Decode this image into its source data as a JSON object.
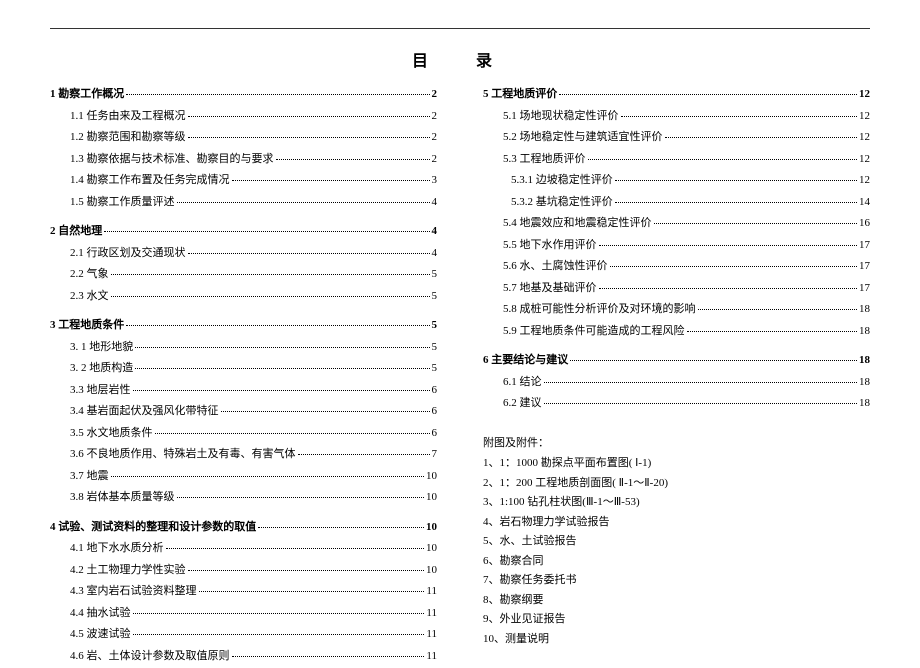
{
  "title": "目　录",
  "left": [
    {
      "type": "chapter",
      "num": "1",
      "label": "勘察工作概况",
      "page": "2"
    },
    {
      "type": "item",
      "indent": 1,
      "num": "1.1",
      "label": "任务由来及工程概况",
      "page": "2"
    },
    {
      "type": "item",
      "indent": 1,
      "num": "1.2",
      "label": "勘察范围和勘察等级",
      "page": "2"
    },
    {
      "type": "item",
      "indent": 1,
      "num": "1.3",
      "label": "勘察依据与技术标准、勘察目的与要求",
      "page": "2"
    },
    {
      "type": "item",
      "indent": 1,
      "num": "1.4",
      "label": "勘察工作布置及任务完成情况",
      "page": "3"
    },
    {
      "type": "item",
      "indent": 1,
      "num": "1.5",
      "label": "勘察工作质量评述",
      "page": "4"
    },
    {
      "type": "gap"
    },
    {
      "type": "chapter",
      "num": "2",
      "label": "自然地理",
      "page": "4"
    },
    {
      "type": "item",
      "indent": 1,
      "num": "2.1",
      "label": "行政区划及交通现状",
      "page": "4"
    },
    {
      "type": "item",
      "indent": 1,
      "num": "2.2",
      "label": "气象",
      "page": "5"
    },
    {
      "type": "item",
      "indent": 1,
      "num": "2.3",
      "label": "水文",
      "page": "5"
    },
    {
      "type": "gap"
    },
    {
      "type": "chapter",
      "num": "3",
      "label": "工程地质条件",
      "page": "5"
    },
    {
      "type": "item",
      "indent": 1,
      "num": "3. 1",
      "label": "地形地貌",
      "page": "5"
    },
    {
      "type": "item",
      "indent": 1,
      "num": "3. 2",
      "label": "地质构造",
      "page": "5"
    },
    {
      "type": "item",
      "indent": 1,
      "num": "3.3",
      "label": "地层岩性",
      "page": "6"
    },
    {
      "type": "item",
      "indent": 1,
      "num": "3.4",
      "label": "基岩面起伏及强风化带特征",
      "page": "6"
    },
    {
      "type": "item",
      "indent": 1,
      "num": "3.5",
      "label": "水文地质条件",
      "page": "6"
    },
    {
      "type": "item",
      "indent": 1,
      "num": "3.6",
      "label": "不良地质作用、特殊岩土及有毒、有害气体",
      "page": "7"
    },
    {
      "type": "item",
      "indent": 1,
      "num": "3.7",
      "label": "地震",
      "page": "10"
    },
    {
      "type": "item",
      "indent": 1,
      "num": "3.8",
      "label": "岩体基本质量等级",
      "page": "10"
    },
    {
      "type": "gap"
    },
    {
      "type": "chapter",
      "num": "4",
      "label": "试验、测试资料的整理和设计参数的取值",
      "page": "10"
    },
    {
      "type": "item",
      "indent": 1,
      "num": "4.1",
      "label": "地下水水质分析",
      "page": "10"
    },
    {
      "type": "item",
      "indent": 1,
      "num": "4.2",
      "label": "土工物理力学性实验",
      "page": "10"
    },
    {
      "type": "item",
      "indent": 1,
      "num": "4.3",
      "label": "室内岩石试验资料整理",
      "page": "11"
    },
    {
      "type": "item",
      "indent": 1,
      "num": "4.4",
      "label": "抽水试验",
      "page": "11"
    },
    {
      "type": "item",
      "indent": 1,
      "num": "4.5",
      "label": "波速试验",
      "page": "11"
    },
    {
      "type": "item",
      "indent": 1,
      "num": "4.6",
      "label": "岩、土体设计参数及取值原则",
      "page": "11"
    }
  ],
  "right": [
    {
      "type": "chapter",
      "num": "5",
      "label": "工程地质评价",
      "page": "12"
    },
    {
      "type": "item",
      "indent": 1,
      "num": "5.1",
      "label": "场地现状稳定性评价",
      "page": "12"
    },
    {
      "type": "item",
      "indent": 1,
      "num": "5.2",
      "label": "场地稳定性与建筑适宜性评价",
      "page": "12"
    },
    {
      "type": "item",
      "indent": 1,
      "num": "5.3",
      "label": "工程地质评价",
      "page": "12"
    },
    {
      "type": "item",
      "indent": 2,
      "num": "5.3.1",
      "label": "边坡稳定性评价",
      "page": "12"
    },
    {
      "type": "item",
      "indent": 2,
      "num": "5.3.2",
      "label": "基坑稳定性评价",
      "page": "14"
    },
    {
      "type": "item",
      "indent": 1,
      "num": "5.4",
      "label": "地震效应和地震稳定性评价",
      "page": "16"
    },
    {
      "type": "item",
      "indent": 1,
      "num": "5.5",
      "label": "地下水作用评价",
      "page": "17"
    },
    {
      "type": "item",
      "indent": 1,
      "num": "5.6",
      "label": "水、土腐蚀性评价",
      "page": "17"
    },
    {
      "type": "item",
      "indent": 1,
      "num": "5.7",
      "label": "地基及基础评价",
      "page": "17"
    },
    {
      "type": "item",
      "indent": 1,
      "num": "5.8",
      "label": "成桩可能性分析评价及对环境的影响",
      "page": "18"
    },
    {
      "type": "item",
      "indent": 1,
      "num": "5.9",
      "label": "工程地质条件可能造成的工程风险",
      "page": "18"
    },
    {
      "type": "gap"
    },
    {
      "type": "chapter",
      "num": "6",
      "label": "主要结论与建议",
      "page": "18"
    },
    {
      "type": "item",
      "indent": 1,
      "num": "6.1",
      "label": "结论",
      "page": "18"
    },
    {
      "type": "item",
      "indent": 1,
      "num": "6.2",
      "label": "建议",
      "page": "18"
    }
  ],
  "appendix_title": "附图及附件：",
  "appendix": [
    "1、1：1000 勘探点平面布置图( Ⅰ-1)",
    "2、1：200 工程地质剖面图( Ⅱ-1～Ⅱ-20)",
    "3、1:100 钻孔柱状图(Ⅲ-1～Ⅲ-53)",
    "4、岩石物理力学试验报告",
    "5、水、土试验报告",
    "6、勘察合同",
    "7、勘察任务委托书",
    "8、勘察纲要",
    "9、外业见证报告",
    "10、测量说明"
  ]
}
